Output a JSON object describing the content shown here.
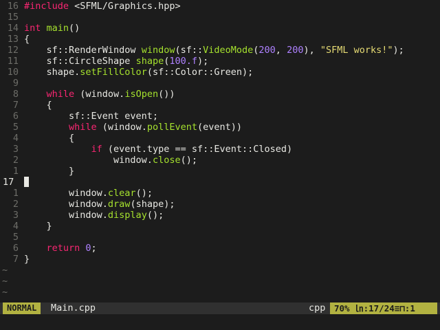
{
  "editor": {
    "lines": [
      {
        "num": "16",
        "tokens": [
          [
            "pre",
            "#include "
          ],
          [
            "plain",
            "<SFML/Graphics.hpp>"
          ]
        ]
      },
      {
        "num": "15",
        "tokens": []
      },
      {
        "num": "14",
        "tokens": [
          [
            "kw",
            "int "
          ],
          [
            "fn",
            "main"
          ],
          [
            "plain",
            "()"
          ]
        ]
      },
      {
        "num": "13",
        "tokens": [
          [
            "plain",
            "{"
          ]
        ]
      },
      {
        "num": "12",
        "tokens": [
          [
            "plain",
            "    sf::RenderWindow "
          ],
          [
            "fn",
            "window"
          ],
          [
            "plain",
            "(sf::"
          ],
          [
            "fn",
            "VideoMode"
          ],
          [
            "plain",
            "("
          ],
          [
            "num",
            "200"
          ],
          [
            "plain",
            ", "
          ],
          [
            "num",
            "200"
          ],
          [
            "plain",
            "), "
          ],
          [
            "str",
            "\"SFML works!\""
          ],
          [
            "plain",
            ");"
          ]
        ]
      },
      {
        "num": "11",
        "tokens": [
          [
            "plain",
            "    sf::CircleShape "
          ],
          [
            "fn",
            "shape"
          ],
          [
            "plain",
            "("
          ],
          [
            "num",
            "100.f"
          ],
          [
            "plain",
            ");"
          ]
        ]
      },
      {
        "num": "10",
        "tokens": [
          [
            "plain",
            "    shape."
          ],
          [
            "fn",
            "setFillColor"
          ],
          [
            "plain",
            "(sf::Color::Green);"
          ]
        ]
      },
      {
        "num": "9",
        "tokens": []
      },
      {
        "num": "8",
        "tokens": [
          [
            "kw",
            "    while "
          ],
          [
            "plain",
            "(window."
          ],
          [
            "fn",
            "isOpen"
          ],
          [
            "plain",
            "())"
          ]
        ]
      },
      {
        "num": "7",
        "tokens": [
          [
            "plain",
            "    {"
          ]
        ]
      },
      {
        "num": "6",
        "tokens": [
          [
            "plain",
            "        sf::Event event;"
          ]
        ]
      },
      {
        "num": "5",
        "tokens": [
          [
            "kw",
            "        while "
          ],
          [
            "plain",
            "(window."
          ],
          [
            "fn",
            "pollEvent"
          ],
          [
            "plain",
            "(event))"
          ]
        ]
      },
      {
        "num": "4",
        "tokens": [
          [
            "plain",
            "        {"
          ]
        ]
      },
      {
        "num": "3",
        "tokens": [
          [
            "kw",
            "            if "
          ],
          [
            "plain",
            "(event.type == sf::Event::Closed)"
          ]
        ]
      },
      {
        "num": "2",
        "tokens": [
          [
            "plain",
            "                window."
          ],
          [
            "fn",
            "close"
          ],
          [
            "plain",
            "();"
          ]
        ]
      },
      {
        "num": "1",
        "tokens": [
          [
            "plain",
            "        }"
          ]
        ]
      },
      {
        "num": "17",
        "current": true,
        "tokens": []
      },
      {
        "num": "1",
        "tokens": [
          [
            "plain",
            "        window."
          ],
          [
            "fn",
            "clear"
          ],
          [
            "plain",
            "();"
          ]
        ]
      },
      {
        "num": "2",
        "tokens": [
          [
            "plain",
            "        window."
          ],
          [
            "fn",
            "draw"
          ],
          [
            "plain",
            "(shape);"
          ]
        ]
      },
      {
        "num": "3",
        "tokens": [
          [
            "plain",
            "        window."
          ],
          [
            "fn",
            "display"
          ],
          [
            "plain",
            "();"
          ]
        ]
      },
      {
        "num": "4",
        "tokens": [
          [
            "plain",
            "    }"
          ]
        ]
      },
      {
        "num": "5",
        "tokens": []
      },
      {
        "num": "6",
        "tokens": [
          [
            "kw",
            "    return "
          ],
          [
            "num",
            "0"
          ],
          [
            "plain",
            ";"
          ]
        ]
      },
      {
        "num": "7",
        "tokens": [
          [
            "plain",
            "}"
          ]
        ]
      }
    ],
    "tilde_rows": [
      "~",
      "~",
      "~"
    ]
  },
  "statusline": {
    "mode": "NORMAL",
    "filename": "Main.cpp",
    "filetype": "cpp",
    "position": "70% ㏑:17/24≡⊓:1"
  },
  "colors": {
    "background": "#1c1c1c",
    "accent": "#b2b241",
    "keyword": "#f92672",
    "function": "#a6e22e",
    "number": "#ae81ff",
    "string": "#e6db74",
    "line_number": "#6d6d68"
  }
}
